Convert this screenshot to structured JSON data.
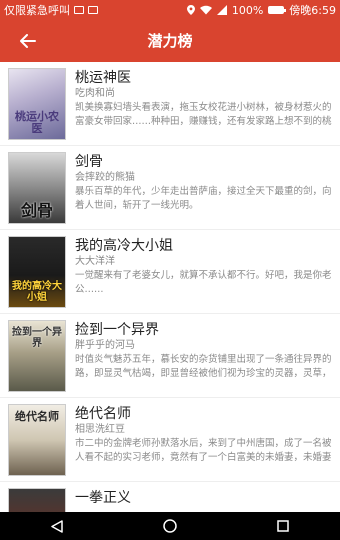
{
  "status_bar": {
    "emergency_text": "仅限紧急呼叫",
    "battery_text": "100%",
    "time_text": "傍晚6:59"
  },
  "header": {
    "title": "潜力榜",
    "background_color": "#d9442f",
    "back_icon": "arrow-back-icon"
  },
  "books": [
    {
      "title": "桃运神医",
      "author": "吃肉和尚",
      "desc": "凯美换寡妇墙头看表演，拖玉女校花进小树林，被身材惹火的富豪女带回家……种种田，赚赚钱，还有发家路上想不到的桃运也节节为你朵朵满天飞！",
      "cover_text": "桃运小农医"
    },
    {
      "title": "剑骨",
      "author": "会摔跤的熊猫",
      "desc": "暴乐百草的年代，少年走出普萨庙，接过全天下最重的剑，向着人世间，斩开了一线光明。",
      "cover_text": "剑骨"
    },
    {
      "title": "我的高冷大小姐",
      "author": "大大洋洋",
      "desc": "一觉醒来有了老婆女儿，就算不承认都不行。好吧，我是你老公……",
      "cover_text": "我的高冷大小姐"
    },
    {
      "title": "捡到一个异界",
      "author": "胖乎乎的河马",
      "desc": "时值炎气魅苏五年，慕长安的杂货铺里出现了一条通往异界的路，即显灵气枯竭，即显曾经被他们视为珍宝的灵器，灵草，丹药，功法武技一夜之间变成了废物。",
      "cover_text": "捡到一个异界"
    },
    {
      "title": "绝代名师",
      "author": "相思洗红豆",
      "desc": "市二中的金牌老师孙默落水后，来到了中州唐国，成了一名被人看不起的实习老师，竟然有了一个白富美的未婚妻，未婚妻竟然还是一所名校的校长，要订婚了。",
      "cover_text": "绝代名师"
    },
    {
      "title": "一拳正义",
      "author": "",
      "desc": "",
      "cover_text": ""
    }
  ],
  "nav": {
    "back_icon": "nav-back-triangle-icon",
    "home_icon": "nav-home-circle-icon",
    "recents_icon": "nav-recents-square-icon"
  }
}
